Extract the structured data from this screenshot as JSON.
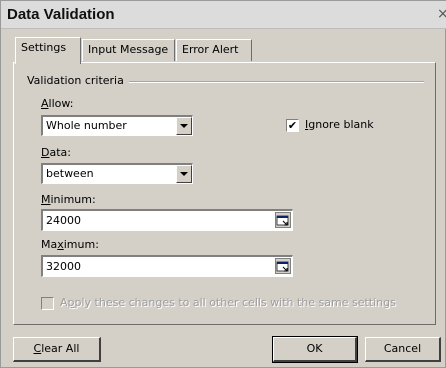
{
  "window": {
    "title": "Data Validation",
    "close_glyph": "×"
  },
  "tabs": [
    {
      "label": "Settings",
      "active": true
    },
    {
      "label": "Input Message",
      "active": false
    },
    {
      "label": "Error Alert",
      "active": false
    }
  ],
  "criteria": {
    "group_label": "Validation criteria",
    "allow": {
      "label_accel": "A",
      "label_rest": "llow:",
      "value": "Whole number"
    },
    "ignore_blank": {
      "label_accel": "I",
      "label_rest": "gnore blank",
      "checked": true,
      "mark": "✔"
    },
    "data": {
      "label_accel": "D",
      "label_rest": "ata:",
      "value": "between"
    },
    "minimum": {
      "label_accel": "M",
      "label_rest": "inimum:",
      "value": "24000"
    },
    "maximum": {
      "label_pre": "Ma",
      "label_accel": "x",
      "label_rest": "imum:",
      "value": "32000"
    },
    "apply_all": {
      "label_pre": "A",
      "label_accel": "p",
      "label_rest": "ply these changes to all other cells with the same settings",
      "checked": false,
      "enabled": false
    }
  },
  "buttons": {
    "clear_all": {
      "label_accel": "C",
      "label_rest": "lear All"
    },
    "ok": {
      "label": "OK"
    },
    "cancel": {
      "label": "Cancel"
    }
  }
}
